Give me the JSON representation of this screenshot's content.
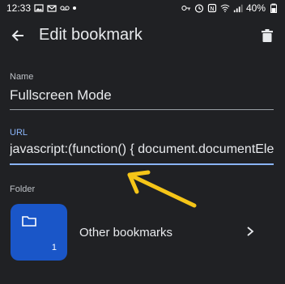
{
  "status_bar": {
    "time": "12:33",
    "battery": "40%"
  },
  "app_bar": {
    "title": "Edit bookmark",
    "back_icon": "arrow-back-icon",
    "delete_icon": "trash-icon"
  },
  "form": {
    "name_label": "Name",
    "name_value": "Fullscreen Mode",
    "url_label": "URL",
    "url_value": "javascript:(function() { document.documentElem",
    "folder_label": "Folder"
  },
  "folder": {
    "name": "Other bookmarks",
    "count": "1",
    "tile_color": "#1a56c8"
  },
  "colors": {
    "background": "#202124",
    "accent": "#8ab4f8",
    "annotation_arrow": "#f5c518"
  }
}
